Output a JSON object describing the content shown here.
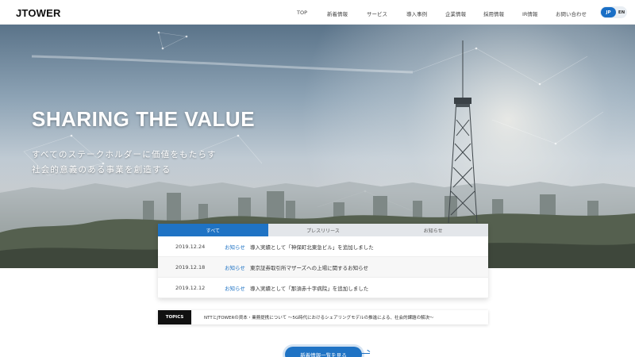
{
  "header": {
    "logo": "JTOWER",
    "nav": [
      "TOP",
      "新着情報",
      "サービス",
      "導入事例",
      "企業情報",
      "採用情報",
      "IR情報",
      "お問い合わせ"
    ],
    "lang": {
      "jp": "JP",
      "en": "EN"
    }
  },
  "hero": {
    "title": "SHARING THE VALUE",
    "subtitle_line1": "すべてのステークホルダーに価値をもたらす",
    "subtitle_line2": "社会的意義のある事業を創造する"
  },
  "news": {
    "tabs": [
      "すべて",
      "プレスリリース",
      "お知らせ"
    ],
    "active_tab": 0,
    "items": [
      {
        "date": "2019.12.24",
        "category": "お知らせ",
        "title": "導入実績として「神保町北東急ビル」を追加しました"
      },
      {
        "date": "2019.12.18",
        "category": "お知らせ",
        "title": "東京証券取引所マザーズへの上場に関するお知らせ"
      },
      {
        "date": "2019.12.12",
        "category": "お知らせ",
        "title": "導入実績として「那須赤十字病院」を追加しました"
      }
    ]
  },
  "topics": {
    "label": "TOPICS",
    "text": "NTTとJTOWERの資本・業務提携について ～5G時代におけるシェアリングモデルの推進による、社会的課題の解決～"
  },
  "more_button": "新着情報一覧を見る",
  "colors": {
    "accent": "#1f73c4",
    "topics_label": "#111111"
  }
}
